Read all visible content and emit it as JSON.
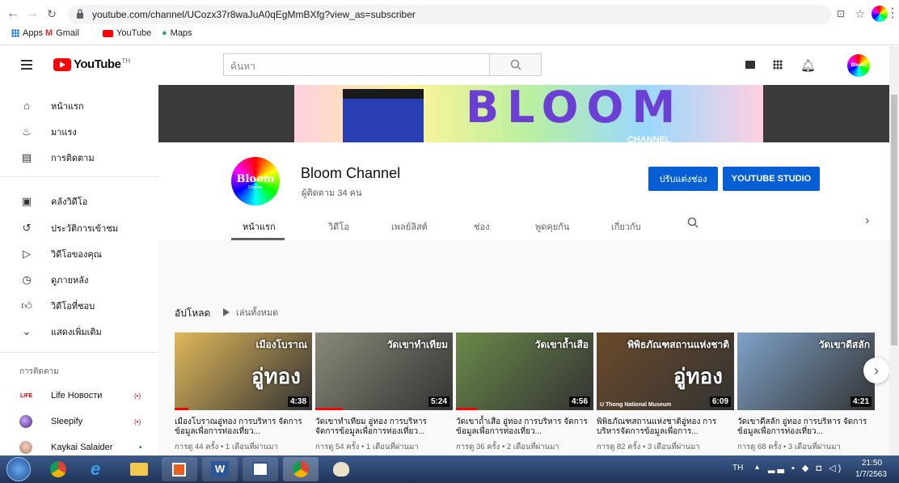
{
  "browser": {
    "url": "youtube.com/channel/UCozx37r8waJuA0qEgMmBXfg?view_as=subscriber",
    "bookmarks": [
      "Apps",
      "Gmail",
      "YouTube",
      "Maps"
    ]
  },
  "masthead": {
    "logo_text": "YouTube",
    "logo_sup": "TH",
    "search_placeholder": "ค้นหา",
    "avatar_text": "Bloom"
  },
  "guide": {
    "main": [
      {
        "label": "หน้าแรก",
        "icon": "home-icon"
      },
      {
        "label": "มาแรง",
        "icon": "flame-icon"
      },
      {
        "label": "การติดตาม",
        "icon": "subscriptions-icon"
      }
    ],
    "library": [
      {
        "label": "คลังวิดีโอ",
        "icon": "library-icon"
      },
      {
        "label": "ประวัติการเข้าชม",
        "icon": "history-icon"
      },
      {
        "label": "วิดีโอของคุณ",
        "icon": "play-square-icon"
      },
      {
        "label": "ดูภายหลัง",
        "icon": "clock-icon"
      },
      {
        "label": "วิดีโอที่ชอบ",
        "icon": "thumbs-up-icon"
      },
      {
        "label": "แสดงเพิ่มเติม",
        "icon": "chevron-down-icon"
      }
    ],
    "subs_heading": "การติดตาม",
    "subs": [
      {
        "label": "Life Новости",
        "live": "(•)"
      },
      {
        "label": "Sleepify",
        "live": "(•)"
      },
      {
        "label": "Kaykai Salaider",
        "live": "•"
      }
    ]
  },
  "banner": {
    "text": "BLOOM",
    "sub": "CHANNEL"
  },
  "channel": {
    "name": "Bloom Channel",
    "subscribers": "ผู้ติดตาม 34 คน",
    "avatar_text": "Bloom",
    "avatar_sub": "Channel",
    "customize_label": "ปรับแต่งช่อง",
    "studio_label": "YOUTUBE STUDIO",
    "tabs": [
      "หน้าแรก",
      "วิดีโอ",
      "เพลย์ลิสต์",
      "ช่อง",
      "พูดคุยกัน",
      "เกี่ยวกับ"
    ],
    "active_tab": 0
  },
  "uploads": {
    "heading": "อัปโหลด",
    "play_all": "เล่นทั้งหมด",
    "videos": [
      {
        "title": "เมืองโบราณอู่ทอง การบริหาร จัดการข้อมูลเพื่อการท่องเที่ยว...",
        "meta": "การดู 44 ครั้ง • 1 เดือนที่ผ่านมา",
        "duration": "4:38",
        "thumb_text": "เมืองโบราณ",
        "thumb_text2": "อู่ทอง",
        "progress": 0.1,
        "bg": "#e0b85a"
      },
      {
        "title": "วัดเขาทำเทียม อู่ทอง การบริหาร จัดการข้อมูลเพื่อการท่องเที่ยว...",
        "meta": "การดู 54 ครั้ง • 1 เดือนที่ผ่านมา",
        "duration": "5:24",
        "thumb_text": "วัดเขาทำเทียม",
        "thumb_text2": "",
        "progress": 0.2,
        "bg": "#8a8a7a"
      },
      {
        "title": "วัดเขาถ้ำเสือ อู่ทอง การบริหาร จัดการข้อมูลเพื่อการท่องเที่ยว...",
        "meta": "การดู 36 ครั้ง • 2 เดือนที่ผ่านมา",
        "duration": "4:56",
        "thumb_text": "วัดเขาถ้ำเสือ",
        "thumb_text2": "",
        "progress": 0.15,
        "bg": "#6b8a4a"
      },
      {
        "title": "พิพิธภัณฑสถานแห่งชาติอู่ทอง การบริหารจัดการข้อมูลเพื่อการ...",
        "meta": "การดู 82 ครั้ง • 3 เดือนที่ผ่านมา",
        "duration": "6:09",
        "thumb_text": "พิพิธภัณฑสถานแห่งชาติ",
        "thumb_text2": "อู่ทอง",
        "progress": 0.0,
        "bg": "#6a4a2a",
        "caption": "U Thong National Museum"
      },
      {
        "title": "วัดเขาดีสลัก อู่ทอง การบริหาร จัดการข้อมูลเพื่อการท่องเที่ยว...",
        "meta": "การดู 68 ครั้ง • 3 เดือนที่ผ่านมา",
        "duration": "4:21",
        "thumb_text": "วัดเขาดีสลัก",
        "thumb_text2": "",
        "progress": 0.0,
        "bg": "#7fa2c8"
      }
    ]
  },
  "taskbar": {
    "lang": "TH",
    "time": "21:50",
    "date": "1/7/2563"
  },
  "colors": {
    "accent": "#065fd4",
    "yt_red": "#ff0000"
  }
}
